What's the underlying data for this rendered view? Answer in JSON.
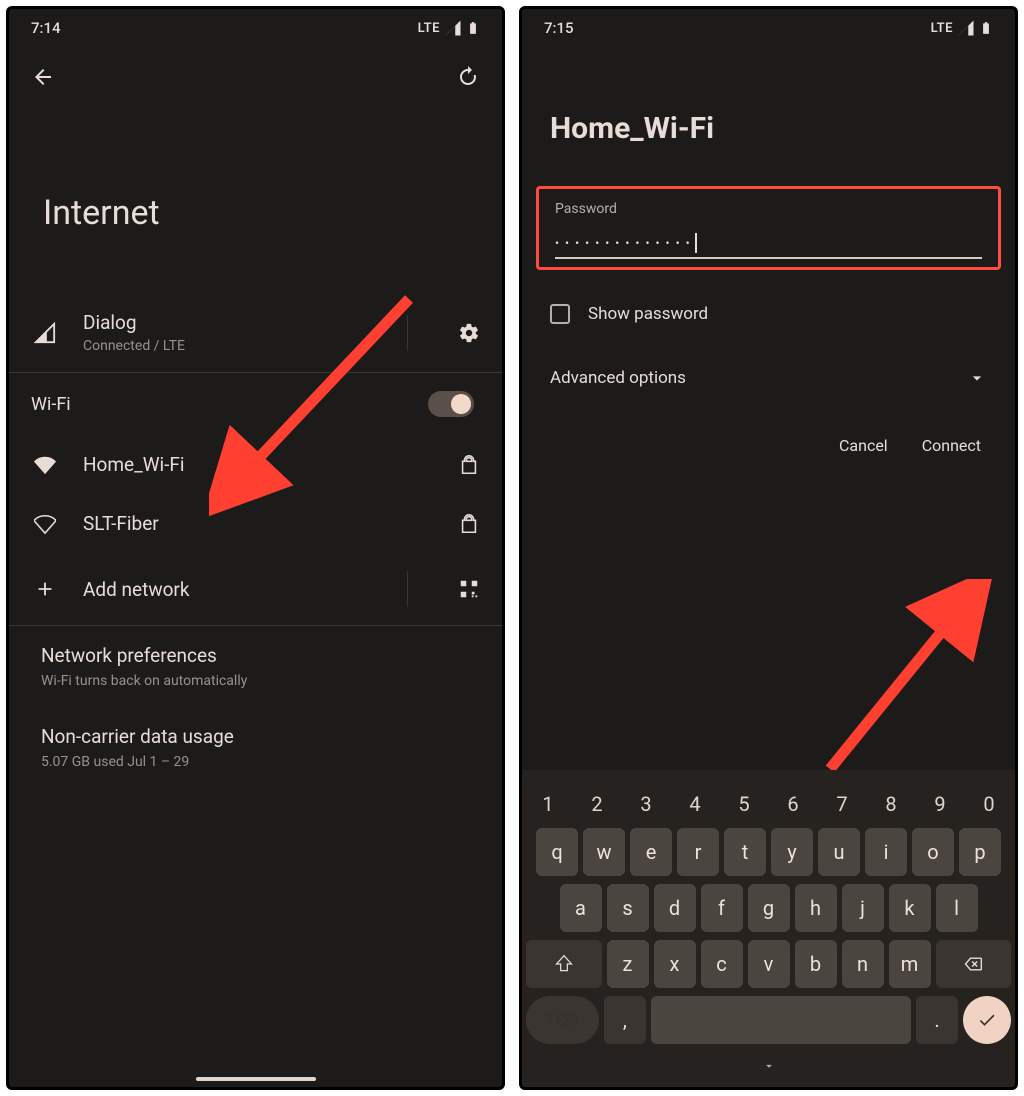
{
  "left": {
    "time": "7:14",
    "signal": "LTE",
    "pageTitle": "Internet",
    "carrier": {
      "name": "Dialog",
      "status": "Connected / LTE"
    },
    "wifiSection": "Wi-Fi",
    "networks": [
      {
        "ssid": "Home_Wi-Fi",
        "locked": true,
        "strong": true
      },
      {
        "ssid": "SLT-Fiber",
        "locked": true,
        "strong": false
      }
    ],
    "addNetwork": "Add network",
    "prefs": {
      "title": "Network preferences",
      "sub": "Wi-Fi turns back on automatically"
    },
    "usage": {
      "title": "Non-carrier data usage",
      "sub": "5.07 GB used Jul 1 – 29"
    }
  },
  "right": {
    "time": "7:15",
    "signal": "LTE",
    "ssid": "Home_Wi-Fi",
    "passwordLabel": "Password",
    "passwordMask": "••••••••••••••",
    "showPw": "Show password",
    "advanced": "Advanced options",
    "cancel": "Cancel",
    "connect": "Connect",
    "keyboard": {
      "numbers": [
        "1",
        "2",
        "3",
        "4",
        "5",
        "6",
        "7",
        "8",
        "9",
        "0"
      ],
      "row1": [
        "q",
        "w",
        "e",
        "r",
        "t",
        "y",
        "u",
        "i",
        "o",
        "p"
      ],
      "row2": [
        "a",
        "s",
        "d",
        "f",
        "g",
        "h",
        "j",
        "k",
        "l"
      ],
      "row3": [
        "z",
        "x",
        "c",
        "v",
        "b",
        "n",
        "m"
      ],
      "sym": "?123",
      "comma": ",",
      "period": "."
    }
  },
  "colors": {
    "accent": "#ff4d3d"
  }
}
